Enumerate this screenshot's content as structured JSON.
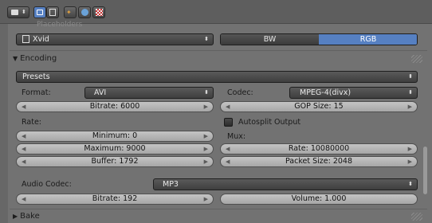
{
  "header": {
    "ghost_label": "Placeholders"
  },
  "codec_row": {
    "codec_dropdown": "Xvid",
    "bw_button": "BW",
    "rgb_button": "RGB"
  },
  "encoding": {
    "panel_title": "Encoding",
    "presets_label": "Presets",
    "format_label": "Format:",
    "format_value": "AVI",
    "codec_label": "Codec:",
    "codec_value": "MPEG-4(divx)",
    "bitrate": "Bitrate: 6000",
    "gop_size": "GOP Size: 15",
    "rate_label": "Rate:",
    "autosplit_label": "Autosplit Output",
    "minimum": "Minimum: 0",
    "mux_label": "Mux:",
    "maximum": "Maximum: 9000",
    "mux_rate": "Rate: 10080000",
    "buffer": "Buffer: 1792",
    "packet_size": "Packet Size: 2048",
    "audio_codec_label": "Audio Codec:",
    "audio_codec_value": "MP3",
    "audio_bitrate": "Bitrate: 192",
    "volume": "Volume: 1.000"
  },
  "bake": {
    "panel_title": "Bake"
  },
  "colors": {
    "rgb_active": "#5680c2",
    "panel_bg": "#727272"
  }
}
